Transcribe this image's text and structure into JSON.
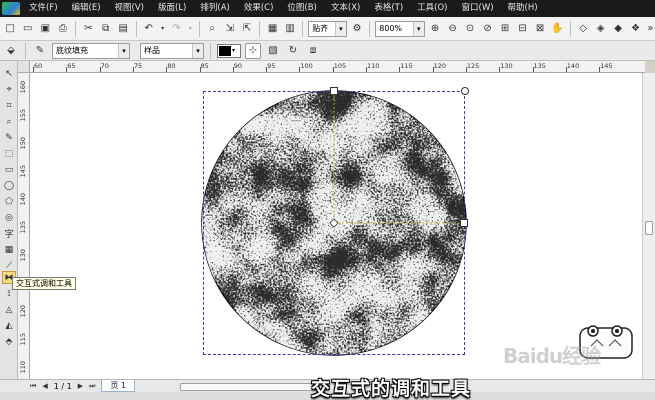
{
  "menu": {
    "items": [
      "文件(F)",
      "编辑(E)",
      "视图(V)",
      "版面(L)",
      "排列(A)",
      "效果(C)",
      "位图(B)",
      "文本(X)",
      "表格(T)",
      "工具(O)",
      "窗口(W)",
      "帮助(H)"
    ]
  },
  "toolbar": {
    "snap_label": "贴齐",
    "zoom_value": "800%"
  },
  "property_bar": {
    "fill_type": "底纹填充",
    "texture_library": "样品",
    "fill_color": "#000000"
  },
  "ruler": {
    "h_ticks": [
      "60",
      "65",
      "70",
      "75",
      "80",
      "85",
      "90",
      "95",
      "100",
      "105",
      "110",
      "115",
      "120",
      "125",
      "130",
      "135",
      "140",
      "145"
    ],
    "v_ticks": [
      "160",
      "155",
      "150",
      "145",
      "140",
      "135",
      "130",
      "125",
      "120",
      "115",
      "110"
    ]
  },
  "tooltip": {
    "text": "交互式调和工具"
  },
  "pagebar": {
    "page_count": "1 / 1",
    "page_tab": "页 1"
  },
  "caption": {
    "text": "交互式的调和工具"
  },
  "watermark": {
    "text": "Baidu经验"
  },
  "colors": {
    "menubar_bg": "#1a1a1a",
    "circle_fill": "#2b2b2b",
    "selection": "#3a3aaa",
    "tooltip_bg": "#ffffe1"
  }
}
